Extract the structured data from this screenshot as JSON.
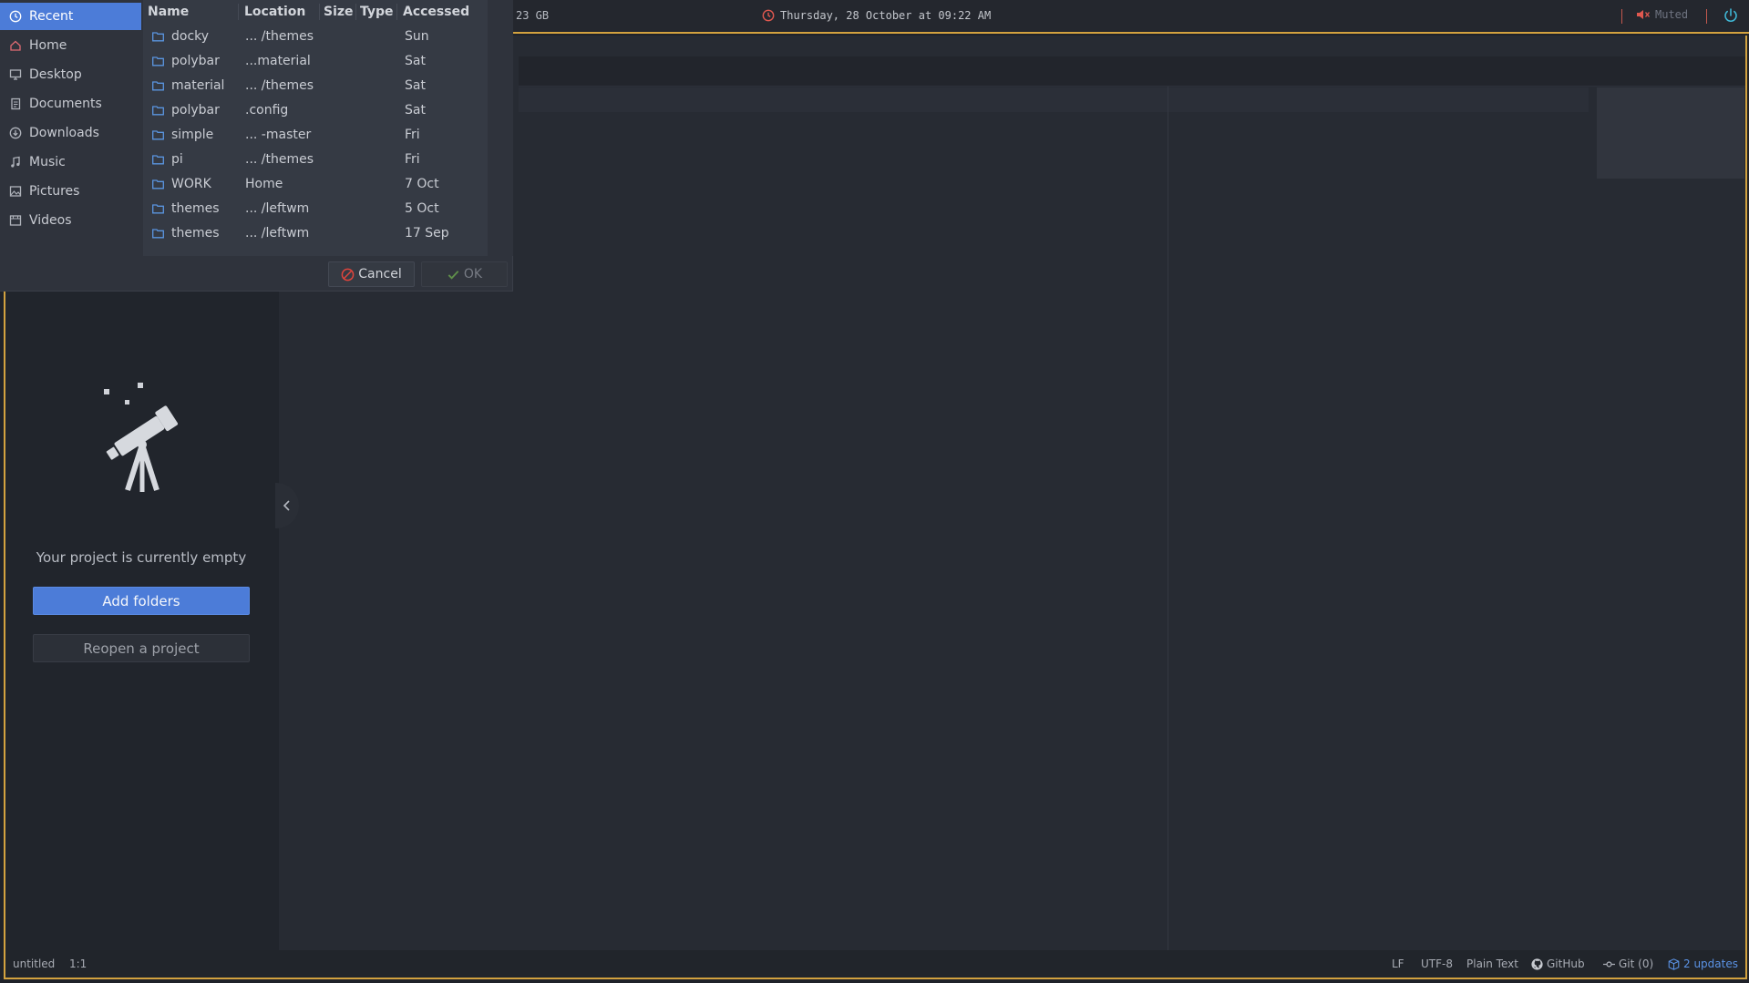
{
  "topbar": {
    "disk": "23 GB",
    "datetime": "Thursday, 28 October at 09:22 AM",
    "volume": "Muted"
  },
  "dialog": {
    "places": [
      {
        "label": "Recent",
        "icon": "clock-icon"
      },
      {
        "label": "Home",
        "icon": "home-icon"
      },
      {
        "label": "Desktop",
        "icon": "desktop-icon"
      },
      {
        "label": "Documents",
        "icon": "documents-icon"
      },
      {
        "label": "Downloads",
        "icon": "download-icon"
      },
      {
        "label": "Music",
        "icon": "music-icon"
      },
      {
        "label": "Pictures",
        "icon": "picture-icon"
      },
      {
        "label": "Videos",
        "icon": "video-icon"
      }
    ],
    "columns": {
      "name": "Name",
      "location": "Location",
      "size": "Size",
      "type": "Type",
      "accessed": "Accessed"
    },
    "files": [
      {
        "name": "docky",
        "location": "... /themes",
        "accessed": "Sun"
      },
      {
        "name": "polybar",
        "location": "...material",
        "accessed": "Sat"
      },
      {
        "name": "material",
        "location": "... /themes",
        "accessed": "Sat"
      },
      {
        "name": "polybar",
        "location": ".config",
        "accessed": "Sat"
      },
      {
        "name": "simple",
        "location": "... -master",
        "accessed": "Fri"
      },
      {
        "name": "pi",
        "location": "... /themes",
        "accessed": "Fri"
      },
      {
        "name": "WORK",
        "location": "Home",
        "accessed": "7 Oct"
      },
      {
        "name": "themes",
        "location": "... /leftwm",
        "accessed": "5 Oct"
      },
      {
        "name": "themes",
        "location": "... /leftwm",
        "accessed": "17 Sep"
      }
    ],
    "cancel_label": "Cancel",
    "ok_label": "OK"
  },
  "tree_view": {
    "empty_message": "Your project is currently empty",
    "add_folders_label": "Add folders",
    "reopen_label": "Reopen a project"
  },
  "statusbar": {
    "file": "untitled",
    "cursor": "1:1",
    "line_ending": "LF",
    "encoding": "UTF-8",
    "grammar": "Plain Text",
    "github": "GitHub",
    "git": "Git (0)",
    "updates": "2 updates"
  },
  "colors": {
    "accent": "#4c7cd8",
    "frame_border": "#d3a23f",
    "alert": "#c3584e",
    "folder_icon": "#5a95e0"
  }
}
